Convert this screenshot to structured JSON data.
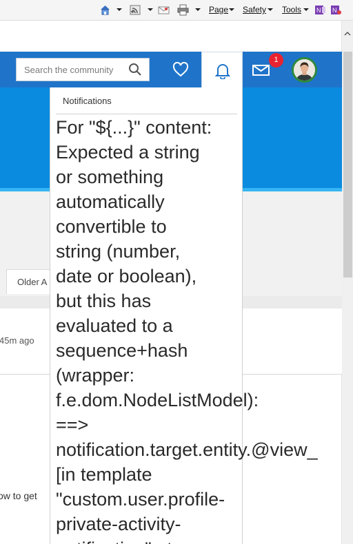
{
  "command_bar": {
    "icons": [
      "home-icon",
      "feeds-icon",
      "mail-icon",
      "print-icon",
      "onenote-icon",
      "onenote-linked-icon"
    ],
    "page_label": "Page",
    "safety_label": "Safety",
    "tools_label": "Tools"
  },
  "header": {
    "search_placeholder": "Search the community",
    "notification_count": "1"
  },
  "notifications": {
    "title": "Notifications",
    "error_text": "For \"${...}\" content:\nExpected a string\nor something\nautomatically\nconvertible to\nstring (number,\ndate or boolean),\nbut this has\nevaluated to a\nsequence+hash\n(wrapper:\nf.e.dom.NodeListModel):\n==>\nnotification.target.entity.@view_\n[in template\n\"custom.user.profile-\nprivate-activity-\nnotification\" at"
  },
  "feed": {
    "older_tab": "Older A",
    "time_ago": "45m ago",
    "body_fragment": "ow to get"
  },
  "colors": {
    "header_blue": "#1f74c9",
    "hero_blue": "#0a8be0",
    "badge_red": "#e8232f"
  }
}
